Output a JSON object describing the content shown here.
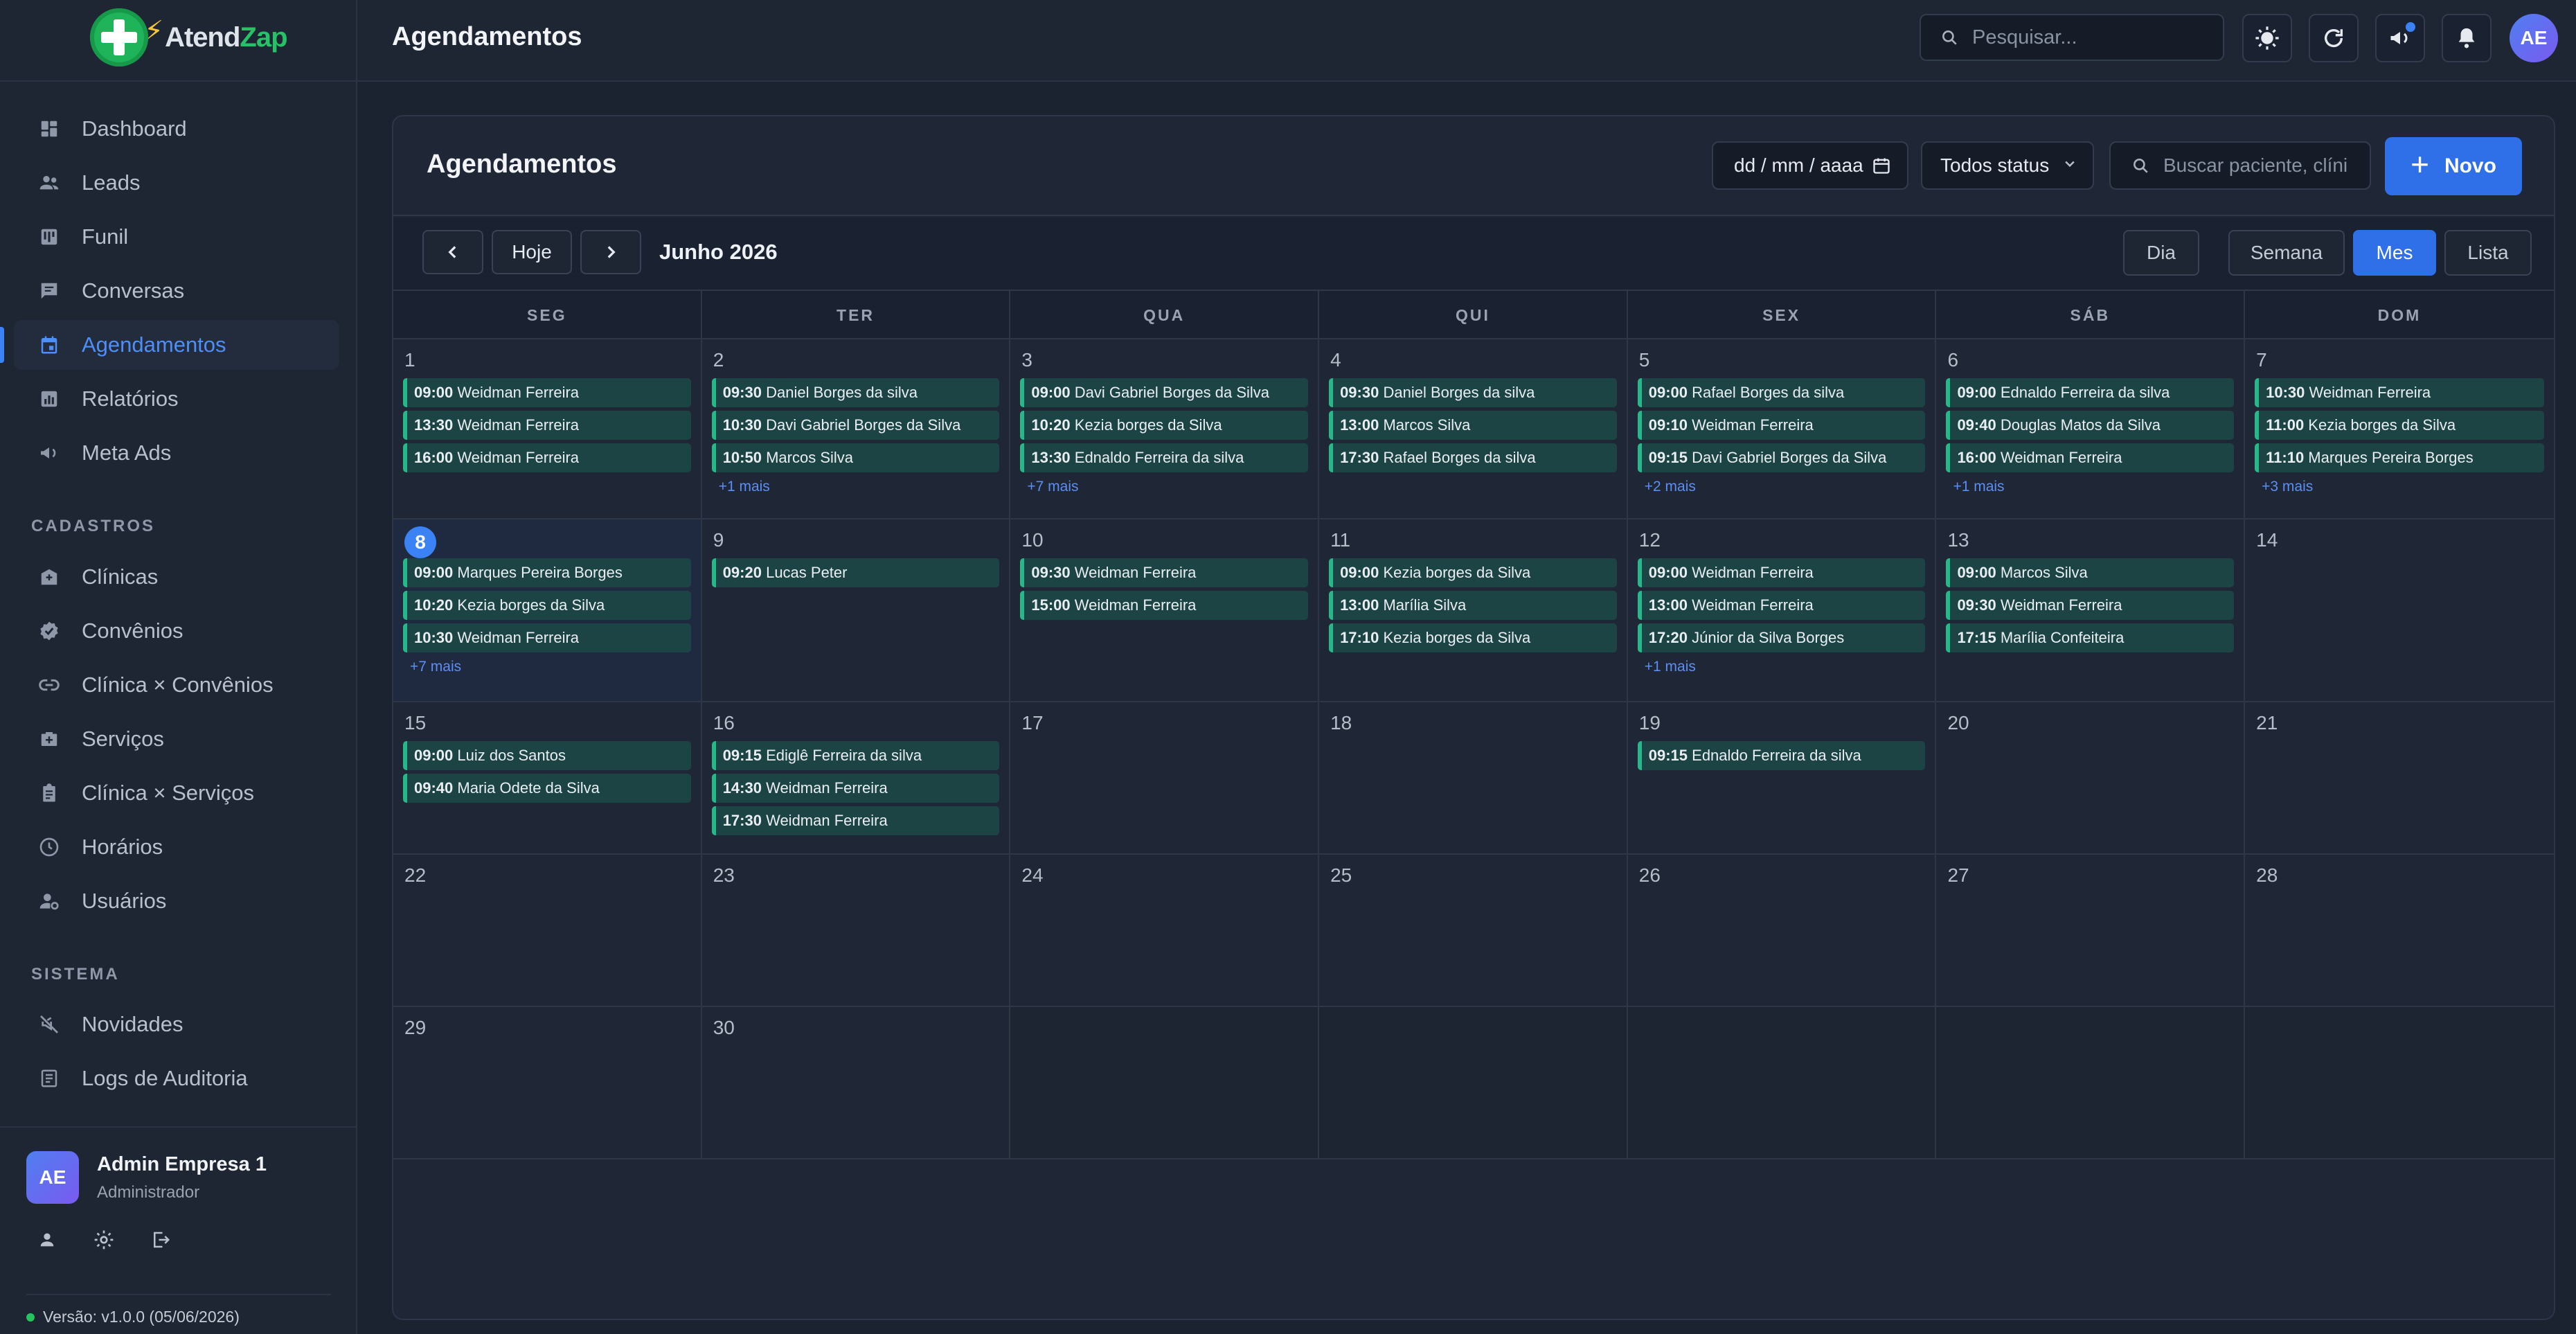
{
  "brand": {
    "name_a": "Atend",
    "name_b": "Zap"
  },
  "sidebar": {
    "main": [
      {
        "label": "Dashboard",
        "icon": "dashboard-icon"
      },
      {
        "label": "Leads",
        "icon": "users-icon"
      },
      {
        "label": "Funil",
        "icon": "funnel-icon"
      },
      {
        "label": "Conversas",
        "icon": "chat-icon"
      },
      {
        "label": "Agendamentos",
        "icon": "calendar-icon",
        "active": true
      },
      {
        "label": "Relatórios",
        "icon": "report-icon"
      },
      {
        "label": "Meta Ads",
        "icon": "megaphone-icon"
      }
    ],
    "cadastros_label": "CADASTROS",
    "cadastros": [
      {
        "label": "Clínicas",
        "icon": "clinic-icon"
      },
      {
        "label": "Convênios",
        "icon": "verified-icon"
      },
      {
        "label": "Clínica × Convênios",
        "icon": "link-icon"
      },
      {
        "label": "Serviços",
        "icon": "medical-bag-icon"
      },
      {
        "label": "Clínica × Serviços",
        "icon": "clipboard-icon"
      },
      {
        "label": "Horários",
        "icon": "clock-icon"
      },
      {
        "label": "Usuários",
        "icon": "user-settings-icon"
      }
    ],
    "sistema_label": "SISTEMA",
    "sistema": [
      {
        "label": "Novidades",
        "icon": "announcement-icon"
      },
      {
        "label": "Logs de Auditoria",
        "icon": "log-icon"
      }
    ],
    "user": {
      "initials": "AE",
      "name": "Admin Empresa 1",
      "role": "Administrador"
    },
    "version": "Versão: v1.0.0 (05/06/2026)"
  },
  "topbar": {
    "title": "Agendamentos",
    "search_placeholder": "Pesquisar...",
    "avatar_initials": "AE"
  },
  "card": {
    "title": "Agendamentos",
    "date_placeholder": "dd / mm / aaaa",
    "status_value": "Todos status",
    "search_placeholder": "Buscar paciente, clíni",
    "new_label": "Novo"
  },
  "calendar": {
    "today_label": "Hoje",
    "month_label": "Junho 2026",
    "views": [
      "Dia",
      "Semana",
      "Mes",
      "Lista"
    ],
    "active_view": "Mes",
    "weekdays": [
      "SEG",
      "TER",
      "QUA",
      "QUI",
      "SEX",
      "SÁB",
      "DOM"
    ],
    "weeks": [
      [
        {
          "day": "1",
          "events": [
            [
              "09:00",
              "Weidman Ferreira"
            ],
            [
              "13:30",
              "Weidman Ferreira"
            ],
            [
              "16:00",
              "Weidman Ferreira"
            ]
          ]
        },
        {
          "day": "2",
          "events": [
            [
              "09:30",
              "Daniel Borges da silva"
            ],
            [
              "10:30",
              "Davi Gabriel Borges da Silva"
            ],
            [
              "10:50",
              "Marcos Silva"
            ]
          ],
          "more": "+1 mais"
        },
        {
          "day": "3",
          "events": [
            [
              "09:00",
              "Davi Gabriel Borges da Silva"
            ],
            [
              "10:20",
              "Kezia borges da Silva"
            ],
            [
              "13:30",
              "Ednaldo Ferreira da silva"
            ]
          ],
          "more": "+7 mais"
        },
        {
          "day": "4",
          "events": [
            [
              "09:30",
              "Daniel Borges da silva"
            ],
            [
              "13:00",
              "Marcos Silva"
            ],
            [
              "17:30",
              "Rafael Borges da silva"
            ]
          ]
        },
        {
          "day": "5",
          "events": [
            [
              "09:00",
              "Rafael Borges da silva"
            ],
            [
              "09:10",
              "Weidman Ferreira"
            ],
            [
              "09:15",
              "Davi Gabriel Borges da Silva"
            ]
          ],
          "more": "+2 mais"
        },
        {
          "day": "6",
          "events": [
            [
              "09:00",
              "Ednaldo Ferreira da silva"
            ],
            [
              "09:40",
              "Douglas Matos da Silva"
            ],
            [
              "16:00",
              "Weidman Ferreira"
            ]
          ],
          "more": "+1 mais"
        },
        {
          "day": "7",
          "events": [
            [
              "10:30",
              "Weidman Ferreira"
            ],
            [
              "11:00",
              "Kezia borges da Silva"
            ],
            [
              "11:10",
              "Marques Pereira Borges"
            ]
          ],
          "more": "+3 mais"
        }
      ],
      [
        {
          "day": "8",
          "today": true,
          "events": [
            [
              "09:00",
              "Marques Pereira Borges"
            ],
            [
              "10:20",
              "Kezia borges da Silva"
            ],
            [
              "10:30",
              "Weidman Ferreira"
            ]
          ],
          "more": "+7 mais"
        },
        {
          "day": "9",
          "events": [
            [
              "09:20",
              "Lucas Peter"
            ]
          ]
        },
        {
          "day": "10",
          "events": [
            [
              "09:30",
              "Weidman Ferreira"
            ],
            [
              "15:00",
              "Weidman Ferreira"
            ]
          ]
        },
        {
          "day": "11",
          "events": [
            [
              "09:00",
              "Kezia borges da Silva"
            ],
            [
              "13:00",
              "Marília Silva"
            ],
            [
              "17:10",
              "Kezia borges da Silva"
            ]
          ]
        },
        {
          "day": "12",
          "events": [
            [
              "09:00",
              "Weidman Ferreira"
            ],
            [
              "13:00",
              "Weidman Ferreira"
            ],
            [
              "17:20",
              "Júnior da Silva Borges"
            ]
          ],
          "more": "+1 mais"
        },
        {
          "day": "13",
          "events": [
            [
              "09:00",
              "Marcos Silva"
            ],
            [
              "09:30",
              "Weidman Ferreira"
            ],
            [
              "17:15",
              "Marília Confeiteira"
            ]
          ]
        },
        {
          "day": "14",
          "events": []
        }
      ],
      [
        {
          "day": "15",
          "events": [
            [
              "09:00",
              "Luiz dos Santos"
            ],
            [
              "09:40",
              "Maria Odete da Silva"
            ]
          ]
        },
        {
          "day": "16",
          "events": [
            [
              "09:15",
              "Ediglê Ferreira da silva"
            ],
            [
              "14:30",
              "Weidman Ferreira"
            ],
            [
              "17:30",
              "Weidman Ferreira"
            ]
          ]
        },
        {
          "day": "17",
          "events": []
        },
        {
          "day": "18",
          "events": []
        },
        {
          "day": "19",
          "events": [
            [
              "09:15",
              "Ednaldo Ferreira da silva"
            ]
          ]
        },
        {
          "day": "20",
          "events": []
        },
        {
          "day": "21",
          "events": []
        }
      ],
      [
        {
          "day": "22",
          "events": []
        },
        {
          "day": "23",
          "events": []
        },
        {
          "day": "24",
          "events": []
        },
        {
          "day": "25",
          "events": []
        },
        {
          "day": "26",
          "events": []
        },
        {
          "day": "27",
          "events": []
        },
        {
          "day": "28",
          "events": []
        }
      ],
      [
        {
          "day": "29",
          "events": []
        },
        {
          "day": "30",
          "events": []
        },
        {
          "day": "",
          "empty": true,
          "events": []
        },
        {
          "day": "",
          "empty": true,
          "events": []
        },
        {
          "day": "",
          "empty": true,
          "events": []
        },
        {
          "day": "",
          "empty": true,
          "events": []
        },
        {
          "day": "",
          "empty": true,
          "events": []
        }
      ]
    ]
  }
}
